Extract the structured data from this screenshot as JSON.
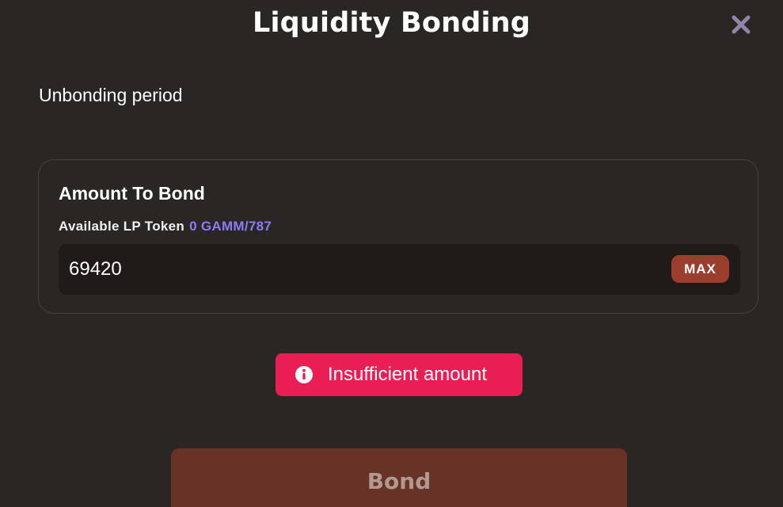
{
  "modal": {
    "title": "Liquidity Bonding",
    "close_icon": "close-icon"
  },
  "unbonding": {
    "label": "Unbonding period"
  },
  "bond_card": {
    "title": "Amount To Bond",
    "available_label": "Available LP Token",
    "available_value": "0 GAMM/787",
    "amount_value": "69420",
    "max_label": "MAX"
  },
  "alert": {
    "icon": "info-icon",
    "message": "Insufficient amount"
  },
  "actions": {
    "bond_label": "Bond"
  },
  "colors": {
    "background": "#2a2623",
    "accent_link": "#8b7cf6",
    "max_button": "#9c3e2e",
    "alert": "#e91e55",
    "bond_button_disabled": "#673327"
  }
}
